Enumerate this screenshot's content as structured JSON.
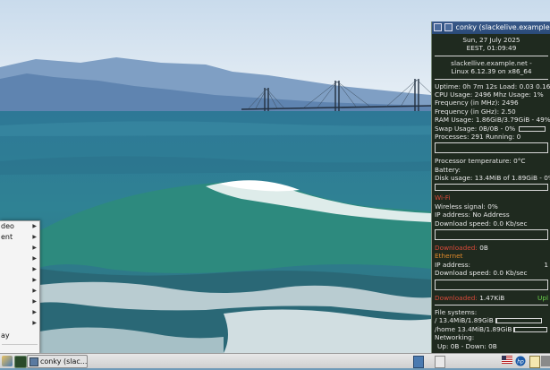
{
  "start_menu": {
    "items": [
      {
        "label": "deo",
        "submenu": true
      },
      {
        "label": "ent",
        "submenu": true
      },
      {
        "label": "",
        "submenu": true
      },
      {
        "label": "",
        "submenu": true
      },
      {
        "label": "",
        "submenu": true
      },
      {
        "label": "",
        "submenu": true
      },
      {
        "label": "",
        "submenu": true
      },
      {
        "label": "",
        "submenu": true
      },
      {
        "label": "",
        "submenu": true
      },
      {
        "label": "",
        "submenu": true
      }
    ],
    "bottom_item": "ay"
  },
  "conky": {
    "title": "conky (slackelive.example.net)",
    "date": "Sun,  27 July 2025",
    "time": "EEST,    01:09:49",
    "host": "slackellive.example.net -",
    "kernel": "Linux 6.12.39 on x86_64",
    "uptime": "Uptime: 0h 7m 12s Load: 0.03 0.16",
    "cpu_usage": "CPU Usage:  2496 Mhz  Usage: 1%",
    "freq_mhz": "Frequency (in MHz): 2496",
    "freq_ghz": "Frequency (in GHz): 2.50",
    "ram": "RAM Usage: 1.86GiB/3.79GiB - 49%",
    "ram_percent": 49,
    "swap": "Swap Usage: 0B/0B - 0%",
    "swap_percent": 0,
    "processes": "Processes: 291  Running: 0",
    "proc_temp": "Processor temperature: 0°C",
    "battery": "Battery:",
    "disk": "Disk usage: 13.4MiB of 1.89GiB - 0%",
    "disk_percent": 0,
    "wifi_header": "Wi-Fi",
    "wifi_signal": "Wireless signal: 0%",
    "wifi_ip": "IP address: No Address",
    "wifi_down": "Download speed: 0.0 Kb/sec",
    "wifi_downloaded_label": "Downloaded:",
    "wifi_downloaded_value": "0B",
    "eth_header": "Ethernet",
    "eth_ip": "IP address:",
    "eth_ip_value": "1",
    "eth_down": "Download speed: 0.0 Kb/sec",
    "eth_downloaded_label": "Downloaded:",
    "eth_downloaded_value": "1.47KiB",
    "eth_upl": "Upl",
    "fs_header": "File systems:",
    "fs_root": "/ 13.4MiB/1.89GiB",
    "fs_root_percent": 1,
    "fs_home": "/home 13.4MiB/1.89GiB",
    "fs_home_percent": 1,
    "net_header": "Networking:",
    "net_updown": "Up: 0B  - Down: 0B",
    "colors": {
      "red": "#d84a3a",
      "green": "#6ad14a",
      "orange": "#e08a2a"
    }
  },
  "taskbar": {
    "task_label": "conky (slac..."
  }
}
